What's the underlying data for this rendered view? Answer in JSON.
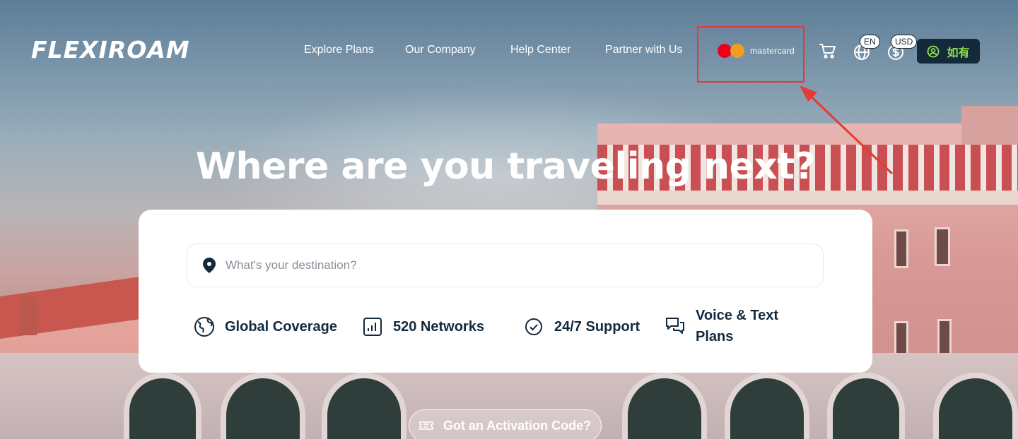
{
  "brand": {
    "logo_text": "FLEXIROAM"
  },
  "nav": {
    "items": [
      {
        "label": "Explore Plans"
      },
      {
        "label": "Our Company"
      },
      {
        "label": "Help Center"
      },
      {
        "label": "Partner with Us"
      }
    ],
    "partner_logo": {
      "text": "mastercard",
      "icon": "mastercard-logo"
    }
  },
  "header_actions": {
    "cart": {
      "icon": "cart-icon"
    },
    "language": {
      "icon": "globe-icon",
      "badge": "EN"
    },
    "currency": {
      "icon": "dollar-icon",
      "badge": "USD"
    },
    "account": {
      "icon": "user-circle-icon",
      "label": "如有"
    }
  },
  "hero": {
    "title": "Where are you traveling next?"
  },
  "search": {
    "placeholder": "What's your destination?",
    "icon": "location-pin-icon"
  },
  "features": [
    {
      "icon": "globe-icon",
      "label": "Global Coverage"
    },
    {
      "icon": "bar-chart-icon",
      "label": "520 Networks"
    },
    {
      "icon": "check-circle-icon",
      "label": "24/7 Support"
    },
    {
      "icon": "chat-bubbles-icon",
      "label_line1": "Voice & Text",
      "label_line2": "Plans"
    }
  ],
  "activation": {
    "label": "Got an Activation Code?",
    "icon": "ticket-icon"
  },
  "colors": {
    "accent_green": "#8ee04a",
    "dark_navy": "#14293a",
    "annotation_red": "#e53935",
    "mastercard_red": "#eb001b",
    "mastercard_orange": "#f79e1b"
  }
}
